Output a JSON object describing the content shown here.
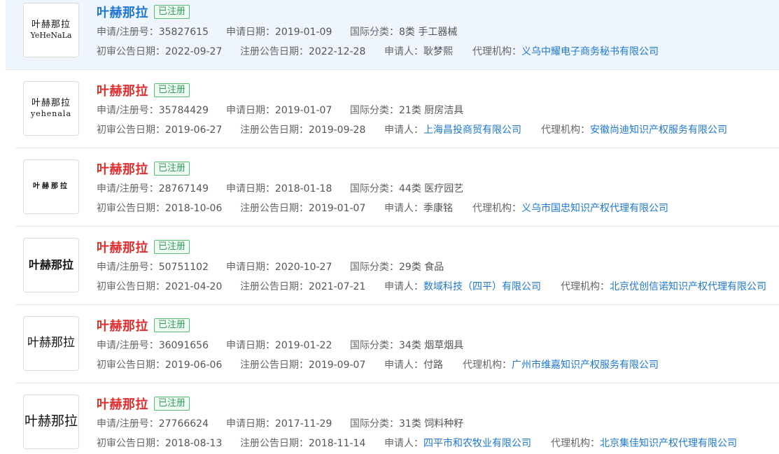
{
  "labels": {
    "reg_no": "申请/注册号：",
    "apply_date": "申请日期：",
    "intl_class": "国际分类：",
    "prelim_date": "初审公告日期：",
    "reg_date": "注册公告日期：",
    "applicant": "申请人：",
    "agent": "代理机构："
  },
  "items": [
    {
      "title": "叶赫那拉",
      "status": "已注册",
      "logo_cn": "叶赫那拉",
      "logo_en": "YeHeNaLa",
      "reg_no": "35827615",
      "apply_date": "2019-01-09",
      "intl_class": "8类 手工器械",
      "prelim_date": "2022-09-27",
      "reg_date": "2022-12-28",
      "applicant": "耿梦熙",
      "agent": "义乌中耀电子商务秘书有限公司"
    },
    {
      "title": "叶赫那拉",
      "status": "已注册",
      "logo_cn": "叶赫那拉",
      "logo_en": "yehenala",
      "reg_no": "35784429",
      "apply_date": "2019-01-07",
      "intl_class": "21类 厨房洁具",
      "prelim_date": "2019-06-27",
      "reg_date": "2019-09-28",
      "applicant": "上海昌投商贸有限公司",
      "agent": "安徽尚迪知识产权服务有限公司"
    },
    {
      "title": "叶赫那拉",
      "status": "已注册",
      "logo_cn": "叶赫那拉",
      "logo_en": "",
      "reg_no": "28767149",
      "apply_date": "2018-01-18",
      "intl_class": "44类 医疗园艺",
      "prelim_date": "2018-10-06",
      "reg_date": "2019-01-07",
      "applicant": "季康铭",
      "agent": "义乌市国忠知识产权代理有限公司"
    },
    {
      "title": "叶赫那拉",
      "status": "已注册",
      "logo_cn": "叶赫那拉",
      "logo_en": "",
      "reg_no": "50751102",
      "apply_date": "2020-10-27",
      "intl_class": "29类 食品",
      "prelim_date": "2021-04-20",
      "reg_date": "2021-07-21",
      "applicant": "数域科技（四平）有限公司",
      "agent": "北京优创信诺知识产权代理有限公司"
    },
    {
      "title": "叶赫那拉",
      "status": "已注册",
      "logo_cn": "叶赫那拉",
      "logo_en": "",
      "reg_no": "36091656",
      "apply_date": "2019-01-22",
      "intl_class": "34类 烟草烟具",
      "prelim_date": "2019-06-06",
      "reg_date": "2019-09-07",
      "applicant": "付路",
      "agent": "广州市维嘉知识产权服务有限公司"
    },
    {
      "title": "叶赫那拉",
      "status": "已注册",
      "logo_cn": "叶赫那拉",
      "logo_en": "",
      "reg_no": "27766624",
      "apply_date": "2017-11-29",
      "intl_class": "31类 饲料种籽",
      "prelim_date": "2018-08-13",
      "reg_date": "2018-11-14",
      "applicant": "四平市和农牧业有限公司",
      "agent": "北京集佳知识产权代理有限公司"
    }
  ]
}
